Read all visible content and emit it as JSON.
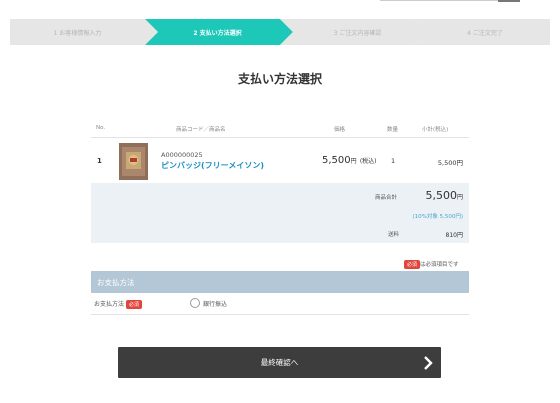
{
  "steps": [
    {
      "label": "1 お客様情報入力",
      "active": false
    },
    {
      "label": "2 支払い方法選択",
      "active": true
    },
    {
      "label": "3 ご注文内容確認",
      "active": false
    },
    {
      "label": "4 ご注文完了",
      "active": false
    }
  ],
  "page_title": "支払い方法選択",
  "table": {
    "headers": {
      "no": "No.",
      "product": "商品コード／商品名",
      "price": "価格",
      "qty": "数量",
      "subtotal": "小計(税込)"
    },
    "rows": [
      {
        "no": "1",
        "code": "A000000025",
        "name": "ピンバッジ(フリーメイソン)",
        "price": "5,500",
        "price_unit": "円",
        "price_tax": "(税込)",
        "qty": "1",
        "subtotal": "5,500円"
      }
    ]
  },
  "summary": {
    "goods_total_label": "商品合計",
    "goods_total_value": "5,500",
    "goods_total_unit": "円",
    "tax_note": "(10%対象 5,500円)",
    "shipping_label": "送料",
    "shipping_value": "810円"
  },
  "required_badge": "必須",
  "required_note": "は必須項目です",
  "payment": {
    "section_title": "お支払方法",
    "row_label": "お支払方法",
    "option_label": "銀行振込"
  },
  "confirm_button": {
    "label": "最終確認へ"
  },
  "colors": {
    "step_active": "#1ec8b8",
    "step_inactive": "#e6e6e6",
    "link": "#1a8fc7",
    "required": "#e0463d",
    "payment_header": "#b4c7d6",
    "button": "#3d3d3d"
  }
}
